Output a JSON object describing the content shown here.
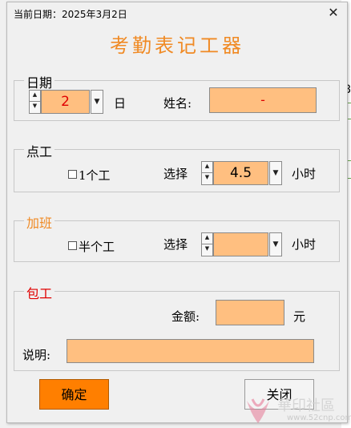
{
  "window": {
    "title": "当前日期：2025年3月2日",
    "close_icon": "close-icon"
  },
  "app_title": "考勤表记工器",
  "sections": {
    "date": {
      "legend": "日期",
      "day_value": "2",
      "day_suffix": "日",
      "name_label": "姓名:",
      "name_value": "-"
    },
    "regular": {
      "legend": "点工",
      "checkbox_label": "1个工",
      "select_label": "选择",
      "hours_value": "4.5",
      "unit": "小时"
    },
    "overtime": {
      "legend": "加班",
      "checkbox_label": "半个工",
      "select_label": "选择",
      "hours_value": "",
      "unit": "小时"
    },
    "contract": {
      "legend": "包工",
      "amount_label": "金额:",
      "amount_value": "",
      "amount_unit": "元",
      "note_label": "说明:",
      "note_value": ""
    }
  },
  "buttons": {
    "confirm": "确定",
    "close": "关闭"
  },
  "background": {
    "cell_fragment": "8"
  },
  "watermark": {
    "text": "華印社區",
    "url": "www.52cnp.com"
  },
  "colors": {
    "accent_orange": "#f08a24",
    "field_fill": "#ffbf80",
    "confirm_button": "#ff7f00",
    "red_text": "#e00000"
  }
}
